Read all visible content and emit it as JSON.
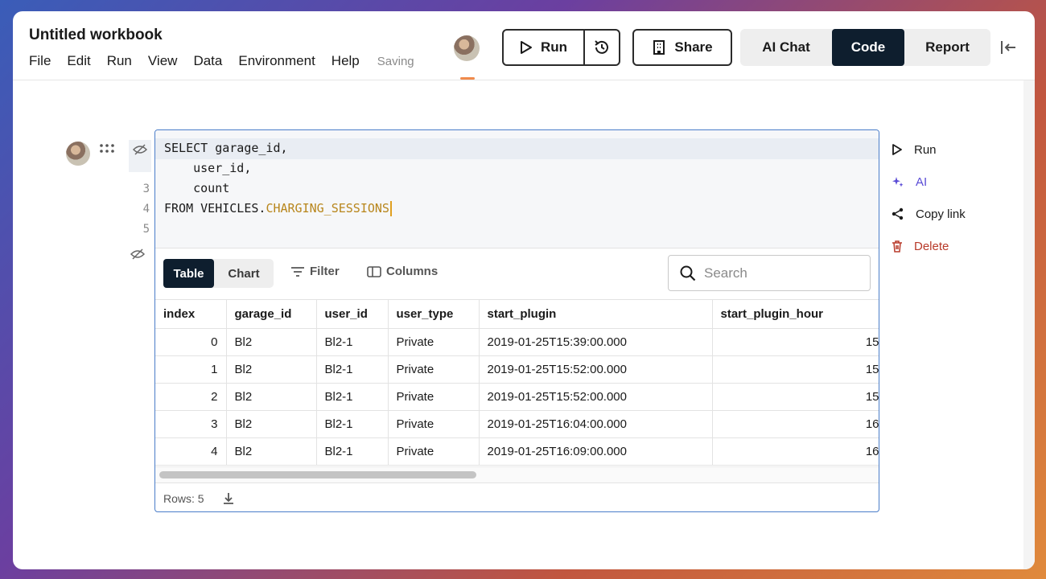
{
  "header": {
    "title": "Untitled workbook",
    "menu": [
      "File",
      "Edit",
      "Run",
      "View",
      "Data",
      "Environment",
      "Help"
    ],
    "status": "Saving",
    "run_label": "Run",
    "share_label": "Share",
    "modes": [
      "AI Chat",
      "Code",
      "Report"
    ],
    "active_mode": "Code"
  },
  "cell": {
    "code_lines": [
      "SELECT garage_id,",
      "    user_id,",
      "    count",
      "FROM VEHICLES.",
      "CHARGING_SESSIONS"
    ],
    "line_numbers": [
      "3",
      "4",
      "5"
    ],
    "view_tabs": [
      "Table",
      "Chart"
    ],
    "active_view": "Table",
    "filter_label": "Filter",
    "columns_label": "Columns",
    "search_placeholder": "Search",
    "table": {
      "columns": [
        "index",
        "garage_id",
        "user_id",
        "user_type",
        "start_plugin",
        "start_plugin_hour"
      ],
      "rows": [
        [
          "0",
          "Bl2",
          "Bl2-1",
          "Private",
          "2019-01-25T15:39:00.000",
          "15"
        ],
        [
          "1",
          "Bl2",
          "Bl2-1",
          "Private",
          "2019-01-25T15:52:00.000",
          "15"
        ],
        [
          "2",
          "Bl2",
          "Bl2-1",
          "Private",
          "2019-01-25T15:52:00.000",
          "15"
        ],
        [
          "3",
          "Bl2",
          "Bl2-1",
          "Private",
          "2019-01-25T16:04:00.000",
          "16"
        ],
        [
          "4",
          "Bl2",
          "Bl2-1",
          "Private",
          "2019-01-25T16:09:00.000",
          "16"
        ]
      ]
    },
    "rows_label": "Rows: 5"
  },
  "side_actions": {
    "run": "Run",
    "ai": "AI",
    "copy_link": "Copy link",
    "delete": "Delete"
  },
  "colors": {
    "accent_dark": "#0e1e2e",
    "cell_border": "#4a7dc9",
    "ai_purple": "#5a4bd6",
    "delete_red": "#b83a2a",
    "highlight_orange": "#b8861c"
  }
}
